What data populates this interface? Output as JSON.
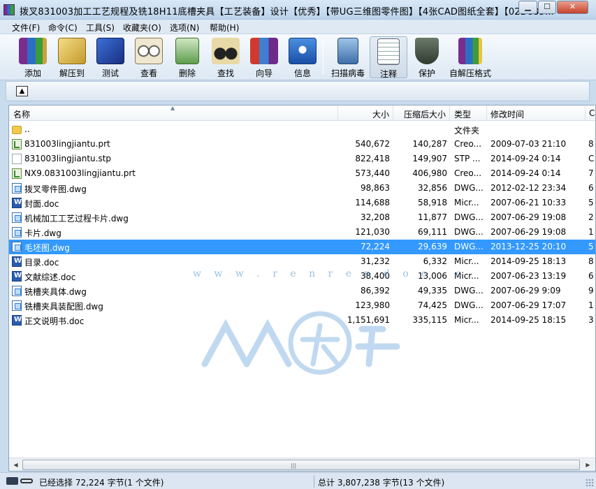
{
  "window": {
    "title": "拨叉831003加工工艺规程及铣18H11底槽夹具【工艺装备】设计【优秀】【带UG三维图零件图】【4张CAD图纸全套】【02BC83...",
    "minimize_glyph": "▁",
    "maximize_glyph": "☐",
    "close_glyph": "✕"
  },
  "menu": [
    {
      "label": "文件(F)"
    },
    {
      "label": "命令(C)"
    },
    {
      "label": "工具(S)"
    },
    {
      "label": "收藏夹(O)"
    },
    {
      "label": "选项(N)"
    },
    {
      "label": "帮助(H)"
    }
  ],
  "toolbar": [
    {
      "label": "添加",
      "icon": "add-archive-icon"
    },
    {
      "label": "解压到",
      "icon": "extract-to-icon"
    },
    {
      "label": "测试",
      "icon": "test-icon"
    },
    {
      "label": "查看",
      "icon": "view-icon"
    },
    {
      "label": "删除",
      "icon": "delete-icon"
    },
    {
      "label": "查找",
      "icon": "find-icon"
    },
    {
      "label": "向导",
      "icon": "wizard-icon"
    },
    {
      "label": "信息",
      "icon": "info-icon"
    },
    {
      "label": "扫描病毒",
      "icon": "virus-scan-icon"
    },
    {
      "label": "注释",
      "icon": "comment-icon"
    },
    {
      "label": "保护",
      "icon": "protect-icon"
    },
    {
      "label": "自解压格式",
      "icon": "sfx-icon"
    }
  ],
  "pathbar": {
    "up_glyph": "▲"
  },
  "columns": {
    "name": "名称",
    "size": "大小",
    "packed": "压缩后大小",
    "type": "类型",
    "mtime": "修改时间",
    "crc": "C"
  },
  "files": [
    {
      "name": "..",
      "size": "",
      "packed": "",
      "type": "文件夹",
      "mtime": "",
      "crc": "",
      "icon": "folder"
    },
    {
      "name": "831003lingjiantu.prt",
      "size": "540,672",
      "packed": "140,287",
      "type": "Creo...",
      "mtime": "2009-07-03 21:10",
      "crc": "8",
      "icon": "prt"
    },
    {
      "name": "831003lingjiantu.stp",
      "size": "822,418",
      "packed": "149,907",
      "type": "STP ...",
      "mtime": "2014-09-24 0:14",
      "crc": "C",
      "icon": "stp"
    },
    {
      "name": "NX9.0831003lingjiantu.prt",
      "size": "573,440",
      "packed": "406,980",
      "type": "Creo...",
      "mtime": "2014-09-24 0:14",
      "crc": "7",
      "icon": "prt"
    },
    {
      "name": "拨叉零件图.dwg",
      "size": "98,863",
      "packed": "32,856",
      "type": "DWG...",
      "mtime": "2012-02-12 23:34",
      "crc": "6",
      "icon": "dwg"
    },
    {
      "name": "封面.doc",
      "size": "114,688",
      "packed": "58,918",
      "type": "Micr...",
      "mtime": "2007-06-21 10:33",
      "crc": "5",
      "icon": "doc"
    },
    {
      "name": "机械加工工艺过程卡片.dwg",
      "size": "32,208",
      "packed": "11,877",
      "type": "DWG...",
      "mtime": "2007-06-29 19:08",
      "crc": "2",
      "icon": "dwg"
    },
    {
      "name": "卡片.dwg",
      "size": "121,030",
      "packed": "69,111",
      "type": "DWG...",
      "mtime": "2007-06-29 19:08",
      "crc": "1",
      "icon": "dwg"
    },
    {
      "name": "毛坯图.dwg",
      "size": "72,224",
      "packed": "29,639",
      "type": "DWG...",
      "mtime": "2013-12-25 20:10",
      "crc": "5",
      "icon": "dwg",
      "selected": true
    },
    {
      "name": "目录.doc",
      "size": "31,232",
      "packed": "6,332",
      "type": "Micr...",
      "mtime": "2014-09-25 18:13",
      "crc": "8",
      "icon": "doc"
    },
    {
      "name": "文献综述.doc",
      "size": "38,400",
      "packed": "13,006",
      "type": "Micr...",
      "mtime": "2007-06-23 13:19",
      "crc": "6",
      "icon": "doc"
    },
    {
      "name": "铣槽夹具体.dwg",
      "size": "86,392",
      "packed": "49,335",
      "type": "DWG...",
      "mtime": "2007-06-29 9:09",
      "crc": "9",
      "icon": "dwg"
    },
    {
      "name": "铣槽夹具装配图.dwg",
      "size": "123,980",
      "packed": "74,425",
      "type": "DWG...",
      "mtime": "2007-06-29 17:07",
      "crc": "1",
      "icon": "dwg"
    },
    {
      "name": "正文说明书.doc",
      "size": "1,151,691",
      "packed": "335,115",
      "type": "Micr...",
      "mtime": "2014-09-25 18:15",
      "crc": "3",
      "icon": "doc"
    }
  ],
  "watermark": {
    "text": "w w w . r e n r e n d o c . c"
  },
  "status": {
    "selected": "已经选择 72,224 字节(1 个文件)",
    "total": "总计 3,807,238 字节(13 个文件)"
  }
}
